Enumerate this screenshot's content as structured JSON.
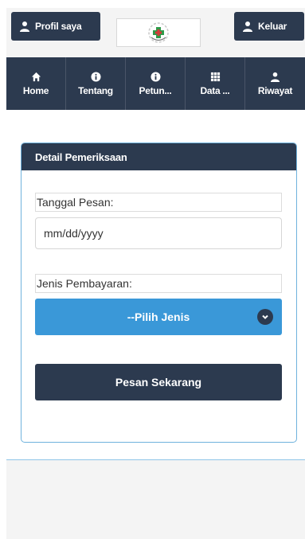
{
  "header": {
    "profile_label": "Profil saya",
    "logout_label": "Keluar",
    "logo_icon": "clinic-logo"
  },
  "nav": {
    "items": [
      {
        "label": "Home",
        "icon": "home-icon"
      },
      {
        "label": "Tentang",
        "icon": "info-icon"
      },
      {
        "label": "Petun...",
        "icon": "info-icon"
      },
      {
        "label": "Data ...",
        "icon": "grid-icon"
      },
      {
        "label": "Riwayat",
        "icon": "user-icon"
      }
    ]
  },
  "form": {
    "title": "Detail Pemeriksaan",
    "date_label": "Tanggal Pesan:",
    "date_placeholder": "mm/dd/yyyy",
    "payment_label": "Jenis Pembayaran:",
    "payment_select": "--Pilih Jenis",
    "submit_label": "Pesan Sekarang"
  },
  "colors": {
    "dark": "#2c3a4f",
    "accent": "#3a98d8",
    "border": "#6fb2dd"
  }
}
